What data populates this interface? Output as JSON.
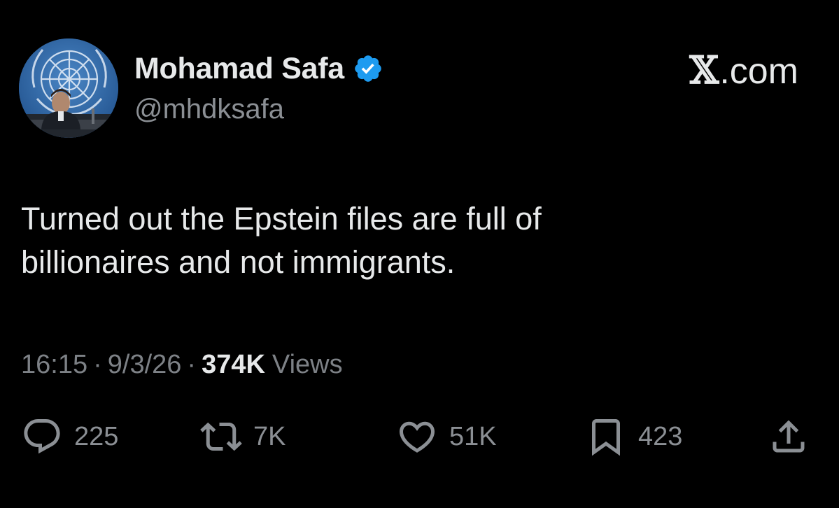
{
  "author": {
    "display_name": "Mohamad Safa",
    "handle": "@mhdksafa",
    "verified": true,
    "verified_color": "#1d9bf0",
    "avatar_icon": "avatar-photo"
  },
  "brand": {
    "x_letter": "𝕏",
    "suffix": ".com"
  },
  "tweet": {
    "lines": [
      "Turned out the Epstein files are full of",
      "billionaires and not immigrants."
    ]
  },
  "meta": {
    "time": "16:15",
    "separator": "·",
    "date": "9/3/26",
    "views_count": "374K",
    "views_label": "Views"
  },
  "actions": {
    "reply": {
      "icon": "reply-icon",
      "count": "225"
    },
    "retweet": {
      "icon": "retweet-icon",
      "count": "7K"
    },
    "like": {
      "icon": "heart-icon",
      "count": "51K"
    },
    "bookmark": {
      "icon": "bookmark-icon",
      "count": "423"
    },
    "share": {
      "icon": "share-icon"
    }
  },
  "colors": {
    "background": "#000000",
    "text_primary": "#e7e9ea",
    "text_secondary": "#8b8f94"
  }
}
